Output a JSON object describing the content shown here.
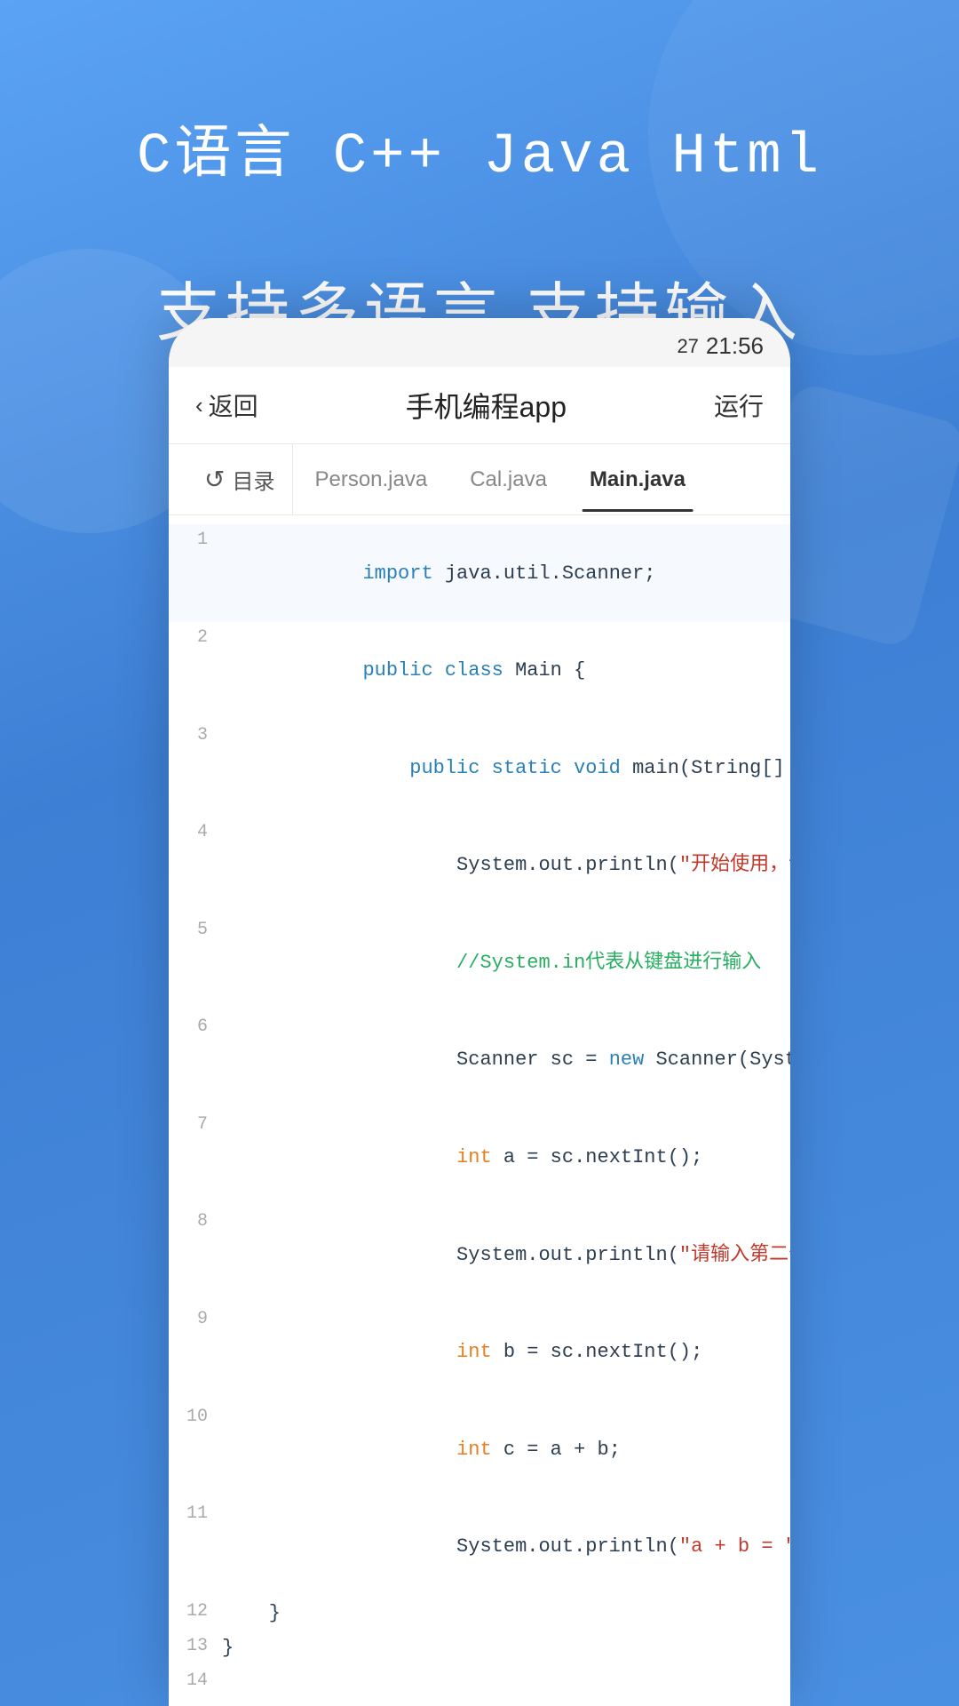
{
  "background": {
    "gradient_start": "#5ba3f5",
    "gradient_end": "#3d7fd4"
  },
  "header": {
    "language_line": "C语言  C++  Java  Html",
    "support_line": "支持多语言 支持输入"
  },
  "status_bar": {
    "battery": "27",
    "time": "21:56"
  },
  "navbar": {
    "back_label": "返回",
    "title": "手机编程app",
    "run_label": "运行"
  },
  "tabs": {
    "directory_label": "目录",
    "tab1_label": "Person.java",
    "tab2_label": "Cal.java",
    "tab3_label": "Main.java"
  },
  "code": {
    "lines": [
      {
        "num": "1",
        "content": "import java.util.Scanner;",
        "type": "import"
      },
      {
        "num": "2",
        "content": "public class Main {",
        "type": "class"
      },
      {
        "num": "3",
        "content": "    public static void main(String[] args){",
        "type": "method"
      },
      {
        "num": "4",
        "content": "        System.out.println(\"开始使用，请输入第一个整数吧。\");",
        "type": "println"
      },
      {
        "num": "5",
        "content": "        //System.in代表从键盘进行输入",
        "type": "comment"
      },
      {
        "num": "6",
        "content": "        Scanner sc = new Scanner(System.in);",
        "type": "code"
      },
      {
        "num": "7",
        "content": "        int a = sc.nextInt();",
        "type": "int"
      },
      {
        "num": "8",
        "content": "        System.out.println(\"请输入第二个整数吧。\");",
        "type": "println"
      },
      {
        "num": "9",
        "content": "        int b = sc.nextInt();",
        "type": "int"
      },
      {
        "num": "10",
        "content": "        int c = a + b;",
        "type": "int"
      },
      {
        "num": "11",
        "content": "        System.out.println(\"a + b = \" + c);",
        "type": "println"
      },
      {
        "num": "12",
        "content": "    }",
        "type": "brace"
      },
      {
        "num": "13",
        "content": "}",
        "type": "brace"
      },
      {
        "num": "14",
        "content": "",
        "type": "empty"
      }
    ]
  }
}
